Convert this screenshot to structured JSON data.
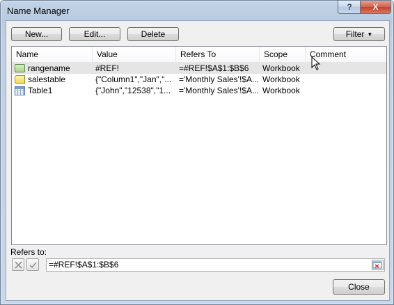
{
  "window": {
    "title": "Name Manager",
    "help_label": "?",
    "close_glyph": "X"
  },
  "toolbar": {
    "new_label": "New...",
    "edit_label": "Edit...",
    "delete_label": "Delete",
    "filter_label": "Filter"
  },
  "table": {
    "columns": [
      "Name",
      "Value",
      "Refers To",
      "Scope",
      "Comment"
    ],
    "rows": [
      {
        "icon": "named-range-icon",
        "name": "rangename",
        "value": "#REF!",
        "refers_to": "=#REF!$A$1:$B$6",
        "scope": "Workbook",
        "comment": ""
      },
      {
        "icon": "named-constant-icon",
        "name": "salestable",
        "value": "{\"Column1\",\"Jan\",\"...",
        "refers_to": "='Monthly Sales'!$A...",
        "scope": "Workbook",
        "comment": ""
      },
      {
        "icon": "table-icon",
        "name": "Table1",
        "value": "{\"John\",\"12538\",\"1...",
        "refers_to": "='Monthly Sales'!$A...",
        "scope": "Workbook",
        "comment": ""
      }
    ],
    "selected_row": 0
  },
  "refers_to": {
    "label": "Refers to:",
    "value": "=#REF!$A$1:$B$6"
  },
  "footer": {
    "close_label": "Close"
  }
}
